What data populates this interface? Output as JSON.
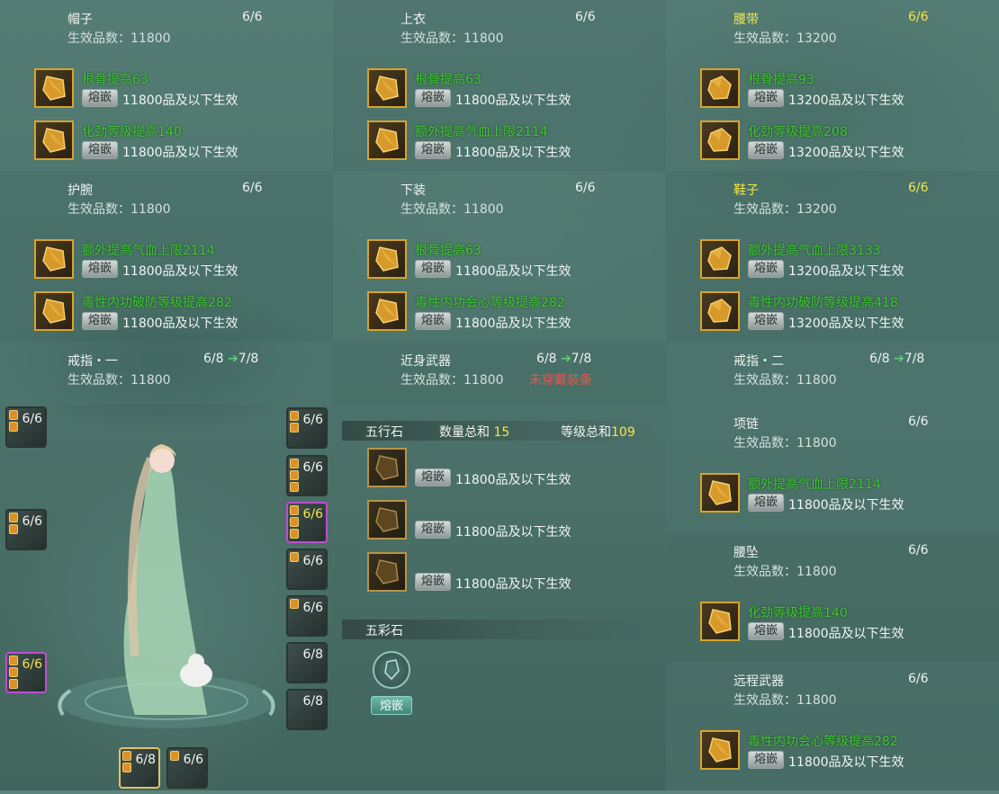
{
  "panels": [
    {
      "id": "hat",
      "title": "帽子",
      "count": "6/6",
      "sub": "生效品数：11800",
      "gold": false,
      "gems": [
        {
          "name": "根骨提高63",
          "btn": "熔嵌",
          "desc": "11800品及以下生效"
        },
        {
          "name": "化劲等级提高140",
          "btn": "熔嵌",
          "desc": "11800品及以下生效"
        }
      ]
    },
    {
      "id": "top",
      "title": "上衣",
      "count": "6/6",
      "sub": "生效品数：11800",
      "gold": false,
      "gems": [
        {
          "name": "根骨提高63",
          "btn": "熔嵌",
          "desc": "11800品及以下生效"
        },
        {
          "name": "额外提高气血上限2114",
          "btn": "熔嵌",
          "desc": "11800品及以下生效"
        }
      ]
    },
    {
      "id": "belt",
      "title": "腰带",
      "count": "6/6",
      "sub": "生效品数：13200",
      "gold": true,
      "gems": [
        {
          "name": "根骨提高93",
          "btn": "熔嵌",
          "desc": "13200品及以下生效"
        },
        {
          "name": "化劲等级提高208",
          "btn": "熔嵌",
          "desc": "13200品及以下生效"
        }
      ]
    },
    {
      "id": "wrist",
      "title": "护腕",
      "count": "6/6",
      "sub": "生效品数：11800",
      "gold": false,
      "gems": [
        {
          "name": "额外提高气血上限2114",
          "btn": "熔嵌",
          "desc": "11800品及以下生效"
        },
        {
          "name": "毒性内功破防等级提高282",
          "btn": "熔嵌",
          "desc": "11800品及以下生效"
        }
      ]
    },
    {
      "id": "pants",
      "title": "下装",
      "count": "6/6",
      "sub": "生效品数：11800",
      "gold": false,
      "gems": [
        {
          "name": "根骨提高63",
          "btn": "熔嵌",
          "desc": "11800品及以下生效"
        },
        {
          "name": "毒性内功会心等级提高282",
          "btn": "熔嵌",
          "desc": "11800品及以下生效"
        }
      ]
    },
    {
      "id": "shoes",
      "title": "鞋子",
      "count": "6/6",
      "sub": "生效品数：13200",
      "gold": true,
      "gems": [
        {
          "name": "额外提高气血上限3133",
          "btn": "熔嵌",
          "desc": "13200品及以下生效"
        },
        {
          "name": "毒性内功破防等级提高418",
          "btn": "熔嵌",
          "desc": "13200品及以下生效"
        }
      ]
    }
  ],
  "ring1": {
    "title": "戒指・一",
    "count": "6/8",
    "next": "7/8",
    "sub": "生效品数：11800"
  },
  "melee": {
    "title": "近身武器",
    "count": "6/8",
    "next": "7/8",
    "sub": "生效品数：11800",
    "warn": "未穿戴装备"
  },
  "ring2": {
    "title": "戒指・二",
    "count": "6/8",
    "next": "7/8",
    "sub": "生效品数：11800"
  },
  "wuxing": {
    "label": "五行石",
    "qty_label": "数量总和",
    "qty": "15",
    "lvl_label": "等级总和",
    "lvl": "109",
    "rows": [
      {
        "btn": "熔嵌",
        "desc": "11800品及以下生效"
      },
      {
        "btn": "熔嵌",
        "desc": "11800品及以下生效"
      },
      {
        "btn": "熔嵌",
        "desc": "11800品及以下生效"
      }
    ]
  },
  "wucai": {
    "label": "五彩石",
    "btn": "熔嵌"
  },
  "necklace": {
    "title": "项链",
    "count": "6/6",
    "sub": "生效品数：11800",
    "gem": {
      "name": "额外提高气血上限2114",
      "btn": "熔嵌",
      "desc": "11800品及以下生效"
    }
  },
  "pendant": {
    "title": "腰坠",
    "count": "6/6",
    "sub": "生效品数：11800",
    "gem": {
      "name": "化劲等级提高140",
      "btn": "熔嵌",
      "desc": "11800品及以下生效"
    }
  },
  "ranged": {
    "title": "远程武器",
    "count": "6/6",
    "sub": "生效品数：11800",
    "gem": {
      "name": "毒性内功会心等级提高282",
      "btn": "熔嵌",
      "desc": "11800品及以下生效"
    }
  },
  "slots_left": [
    {
      "count": "6/6"
    },
    {
      "count": "6/6"
    },
    {
      "count": "6/6"
    }
  ],
  "slots_right": [
    {
      "count": "6/6"
    },
    {
      "count": "6/6"
    },
    {
      "count": "6/6"
    },
    {
      "count": "6/6"
    },
    {
      "count": "6/6"
    },
    {
      "count": "6/8"
    },
    {
      "count": "6/8"
    }
  ],
  "slots_bottom": [
    {
      "count": "6/8"
    },
    {
      "count": "6/6"
    }
  ],
  "colors": {
    "gem_green": "#43c43a",
    "gold": "#f3e64a",
    "warn_red": "#e2574e",
    "accent_teal": "#3f8876"
  }
}
